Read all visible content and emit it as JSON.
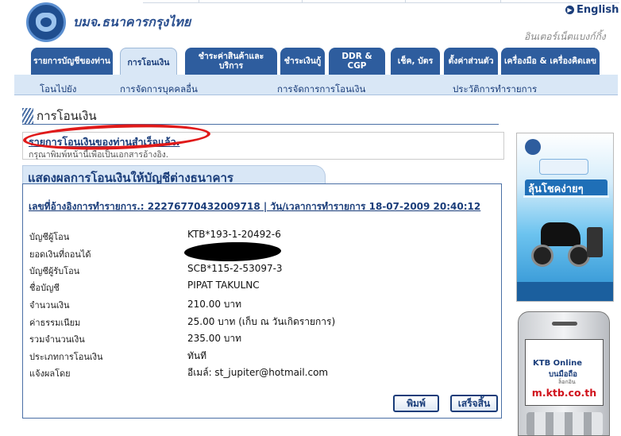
{
  "header": {
    "bank_name": "บมจ.ธนาคารกรุงไทย",
    "language_link": "English",
    "tagline": "อินเตอร์เน็ตแบงก์กิ้ง"
  },
  "tabs": [
    {
      "label": "รายการบัญชีของท่าน"
    },
    {
      "label": "การโอนเงิน",
      "active": true
    },
    {
      "label": "ชำระค่าสินค้าและบริการ"
    },
    {
      "label": "ชำระเงินกู้"
    },
    {
      "label": "DDR & CGP"
    },
    {
      "label": "เช็ค, บัตร"
    },
    {
      "label": "ตั้งค่าส่วนตัว"
    },
    {
      "label": "เครื่องมือ & เครื่องคิดเลข"
    }
  ],
  "subnav": [
    {
      "label": "โอนไปยัง"
    },
    {
      "label": "การจัดการบุคคลอื่น"
    },
    {
      "label": "การจัดการการโอนเงิน"
    },
    {
      "label": "ประวัติการทำรายการ"
    }
  ],
  "section_title": "การโอนเงิน",
  "success": {
    "message": "รายการโอนเงินของท่านสำเร็จแล้ว.",
    "hint": "กรุณาพิมพ์หน้านี้เพื่อเป็นเอกสารอ้างอิง."
  },
  "result": {
    "panel_title": "แสดงผลการโอนเงินให้บัญชีต่างธนาคาร",
    "reference_line": "เลขที่อ้างอิงการทำรายการ.: 22276770432009718 | วัน/เวลาการทำรายการ 18-07-2009 20:40:12",
    "rows": [
      {
        "label": "บัญชีผู้โอน",
        "value": "KTB*193-1-20492-6"
      },
      {
        "label": "ยอดเงินที่ถอนได้",
        "value": ""
      },
      {
        "label": "บัญชีผู้รับโอน",
        "value": "SCB*115-2-53097-3"
      },
      {
        "label": "ชื่อบัญชี",
        "value": "PIPAT TAKULNC"
      },
      {
        "label": "จำนวนเงิน",
        "value": "210.00 บาท"
      },
      {
        "label": "ค่าธรรมเนียม",
        "value": "25.00 บาท (เก็บ ณ วันเกิดรายการ)"
      },
      {
        "label": "รวมจำนวนเงิน",
        "value": "235.00 บาท"
      },
      {
        "label": "ประเภทการโอนเงิน",
        "value": "ทันที"
      },
      {
        "label": "แจ้งผลโดย",
        "value": "อีเมล์: st_jupiter@hotmail.com"
      }
    ],
    "print_button": "พิมพ์",
    "done_button": "เสร็จสิ้น"
  },
  "ads": {
    "promo_headline": "ลุ้นโชคง่ายๆ",
    "phone_line1": "KTB Online",
    "phone_line2": "บนมือถือ",
    "phone_line3": "ล็อกอิน",
    "phone_url": "m.ktb.co.th"
  }
}
